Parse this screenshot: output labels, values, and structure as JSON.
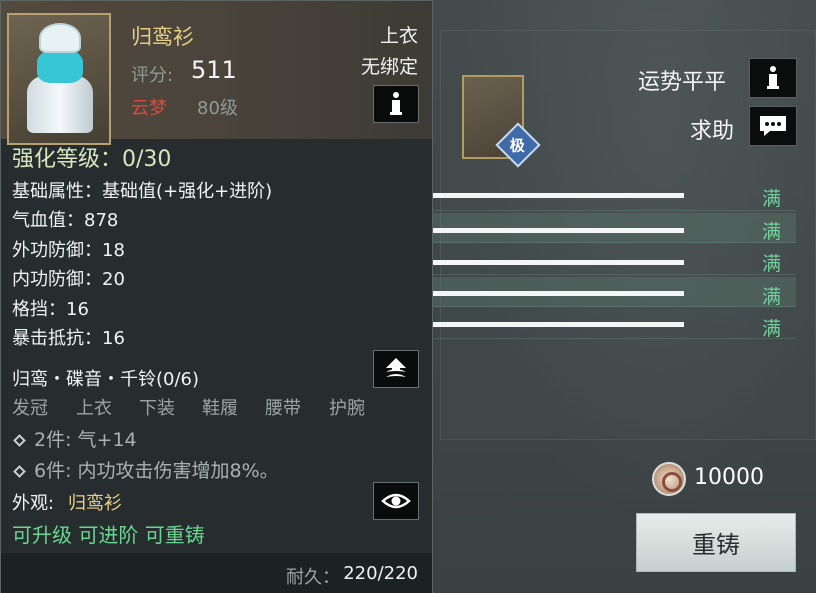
{
  "item": {
    "name": "归鸾衫",
    "score_label": "评分:",
    "score": "511",
    "sect": "云梦",
    "level": "80级",
    "slot_type": "上衣",
    "bind_status": "无绑定"
  },
  "tooltip": {
    "enhance_level": "强化等级：0/30",
    "attr_header": "基础属性：基础值(+强化+进阶)",
    "attributes": [
      "气血值：878",
      "外功防御：18",
      "内功防御：20",
      "格挡：16",
      "暴击抵抗：16"
    ],
    "set_name": "归鸾・碟音・千铃(0/6)",
    "set_slots": [
      "发冠",
      "上衣",
      "下装",
      "鞋履",
      "腰带",
      "护腕"
    ],
    "set_bonuses": [
      "2件: 气+14",
      "6件: 内功攻击伤害增加8%。"
    ],
    "appearance_label": "外观:",
    "appearance_value": "归鸾衫",
    "upgrade_status": "可升级 可进阶 可重铸",
    "durability_label": "耐久：",
    "durability_value": "220/220"
  },
  "panel": {
    "fortune_label": "运势平平",
    "help_label": "求助",
    "item_badge": "极",
    "full_labels": [
      "满",
      "满",
      "满",
      "满",
      "满"
    ],
    "currency_amount": "10000",
    "reforge_button": "重铸"
  },
  "icons": {
    "info": "info-icon",
    "chat": "chat-icon",
    "upgrade": "upgrade-icon",
    "eye": "eye-icon",
    "coin": "coin-icon",
    "badge": "diamond-badge-icon"
  },
  "colors": {
    "item_name": "#e7cf86",
    "sect": "#d94a3e",
    "full": "#6fd19b",
    "upgrade_status": "#68d692",
    "enhance": "#d7e6bf"
  }
}
